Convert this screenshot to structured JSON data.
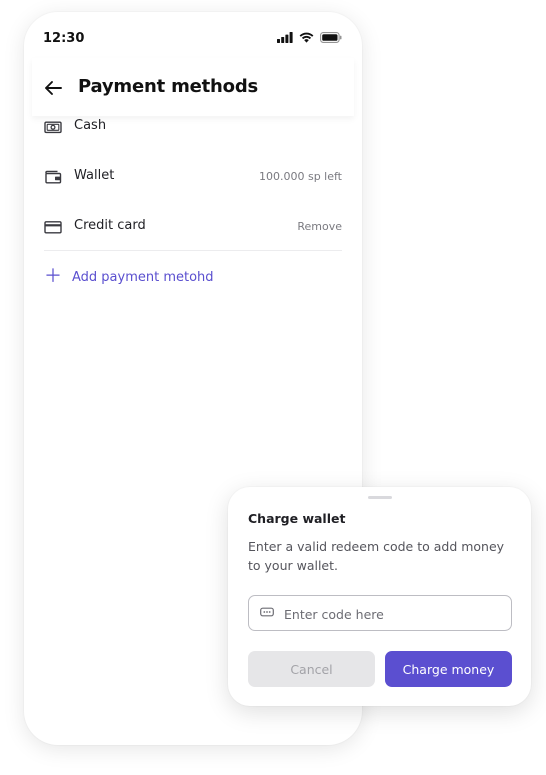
{
  "status_bar": {
    "time": "12:30"
  },
  "header": {
    "title": "Payment methods"
  },
  "methods": [
    {
      "label": "Cash",
      "meta": "",
      "icon": "cash-icon"
    },
    {
      "label": "Wallet",
      "meta": "100.000 sp left",
      "icon": "wallet-icon"
    },
    {
      "label": "Credit card",
      "meta": "Remove",
      "icon": "credit-card-icon"
    }
  ],
  "add_method": {
    "label": "Add payment metohd",
    "icon": "plus-icon"
  },
  "sheet": {
    "title": "Charge wallet",
    "description": "Enter a valid redeem code to add money to your wallet.",
    "code_placeholder": "Enter code here",
    "code_value": "",
    "cancel_label": "Cancel",
    "charge_label": "Charge money"
  },
  "colors": {
    "accent": "#5b4fd0",
    "muted": "#7a7a80",
    "disabled_bg": "#e6e6e8"
  }
}
